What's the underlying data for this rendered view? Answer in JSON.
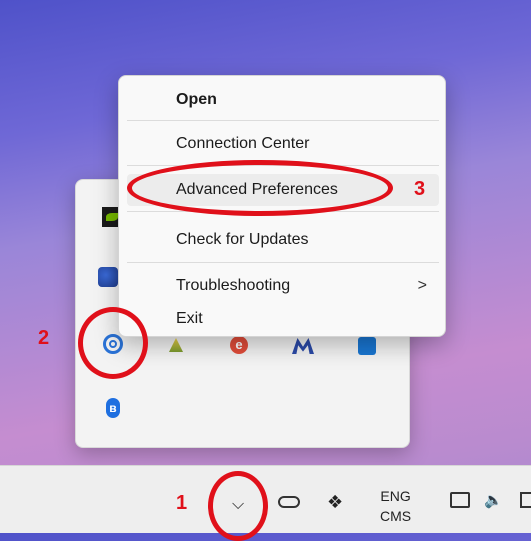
{
  "context_menu": {
    "items": [
      {
        "label": "Open"
      },
      {
        "label": "Connection Center"
      },
      {
        "label": "Advanced Preferences"
      },
      {
        "label": "Check for Updates"
      },
      {
        "label": "Troubleshooting"
      },
      {
        "label": "Exit"
      }
    ],
    "submenu_indicator": ">"
  },
  "tray_flyout": {
    "icons": [
      "nvidia-icon",
      "app-icon",
      "globalprotect-icon",
      "yellow-app-icon",
      "e-app-icon",
      "m-app-icon",
      "blue-square-icon",
      "bluetooth-icon"
    ],
    "e_icon_glyph": "e",
    "bluetooth_glyph": "ʙ"
  },
  "taskbar": {
    "overflow_chevron": "⌵",
    "dropbox_glyph": "❖",
    "language_line1": "ENG",
    "language_line2": "CMS",
    "volume_glyph": "🔈"
  },
  "annotations": {
    "step1": "1",
    "step2": "2",
    "step3": "3",
    "color": "#e0101a"
  }
}
